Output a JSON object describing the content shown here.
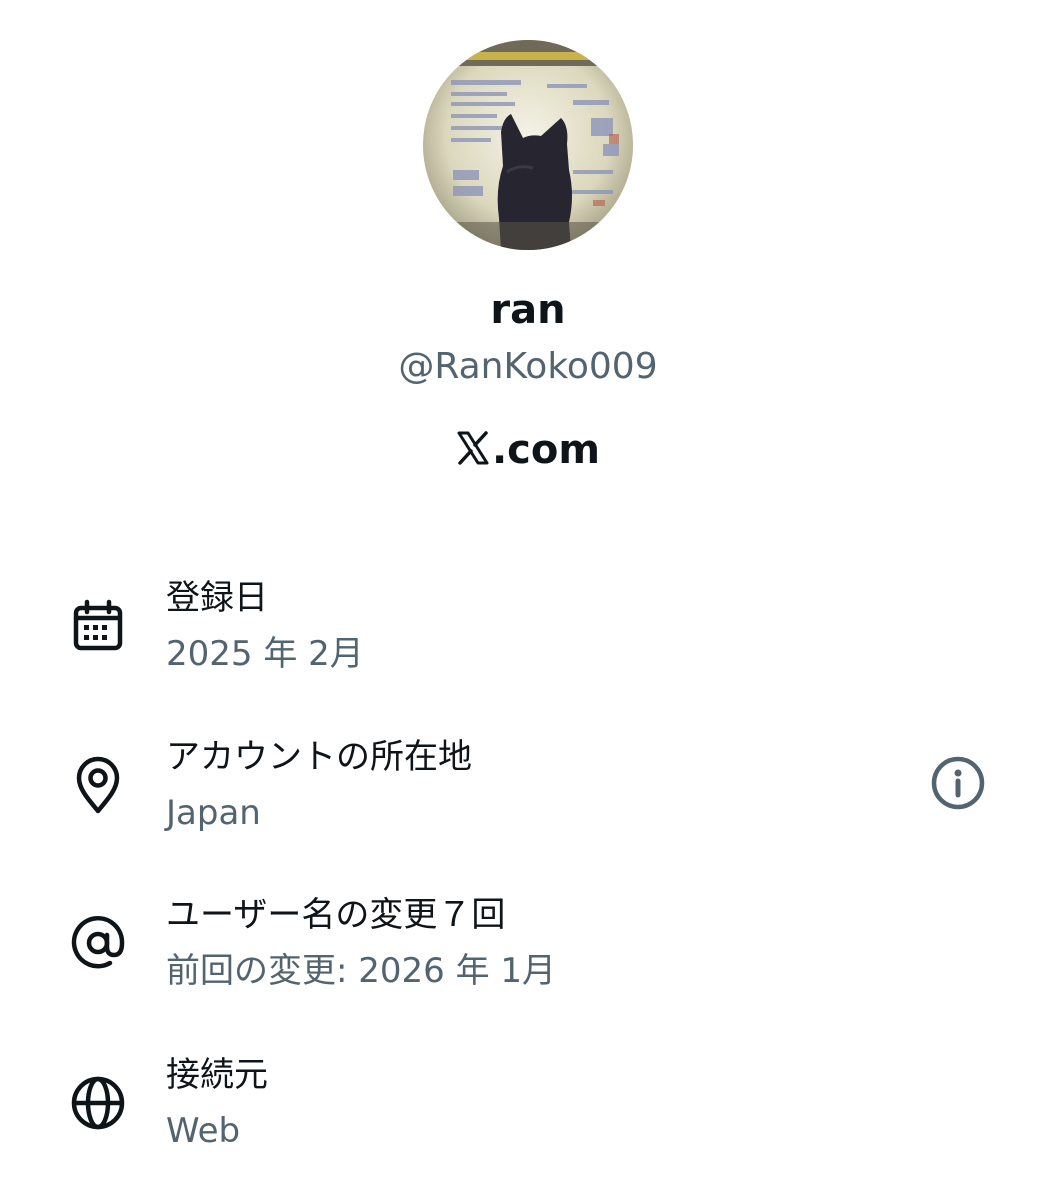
{
  "profile": {
    "display_name": "ran",
    "handle": "@RanKoko009",
    "site_label": ".com",
    "site_logo_glyph": "𝕏",
    "avatar_description_icon": "cat-avatar"
  },
  "about": {
    "joined": {
      "icon": "calendar-icon",
      "title": "登録日",
      "value": "2025 年 2月"
    },
    "location": {
      "icon": "location-pin-icon",
      "title": "アカウントの所在地",
      "value": "Japan",
      "info_icon": "info-icon"
    },
    "username_changes": {
      "icon": "at-sign-icon",
      "title": "ユーザー名の変更７回",
      "value": "前回の変更: 2026 年 1月"
    },
    "connected_via": {
      "icon": "globe-icon",
      "title": "接続元",
      "value": "Web"
    }
  },
  "colors": {
    "primary_text": "#0f1419",
    "secondary_text": "#536471",
    "background": "#ffffff"
  }
}
